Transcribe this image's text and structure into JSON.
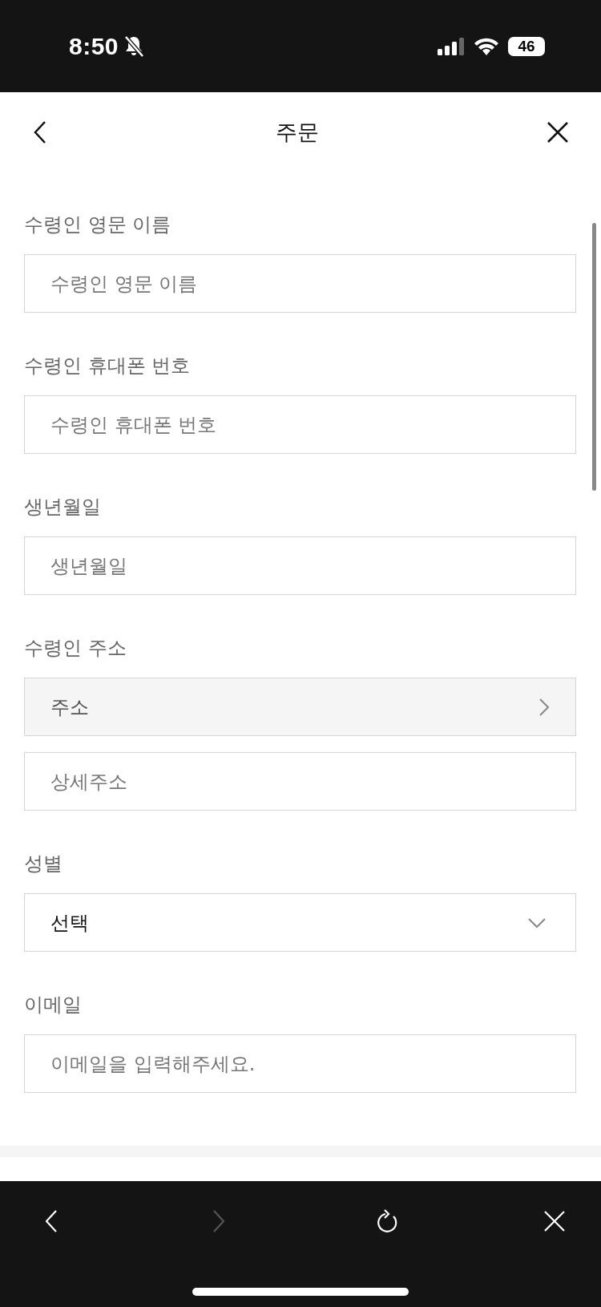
{
  "status_bar": {
    "time": "8:50",
    "battery": "46"
  },
  "header": {
    "title": "주문"
  },
  "form": [
    {
      "label": "수령인 영문 이름",
      "inputs": [
        {
          "kind": "input",
          "placeholder": "수령인 영문 이름"
        }
      ]
    },
    {
      "label": "수령인 휴대폰 번호",
      "inputs": [
        {
          "kind": "input",
          "placeholder": "수령인 휴대폰 번호"
        }
      ]
    },
    {
      "label": "생년월일",
      "inputs": [
        {
          "kind": "input",
          "placeholder": "생년월일"
        }
      ]
    },
    {
      "label": "수령인 주소",
      "inputs": [
        {
          "kind": "picker",
          "value": "주소"
        },
        {
          "kind": "input",
          "placeholder": "상세주소"
        }
      ]
    },
    {
      "label": "성별",
      "inputs": [
        {
          "kind": "select",
          "value": "선택"
        }
      ]
    },
    {
      "label": "이메일",
      "inputs": [
        {
          "kind": "input",
          "placeholder": "이메일을 입력해주세요."
        }
      ]
    }
  ],
  "browser_toolbar": [
    {
      "kind": "back",
      "disabled": false
    },
    {
      "kind": "forward",
      "disabled": true
    },
    {
      "kind": "reload",
      "disabled": false
    },
    {
      "kind": "close",
      "disabled": false
    }
  ]
}
